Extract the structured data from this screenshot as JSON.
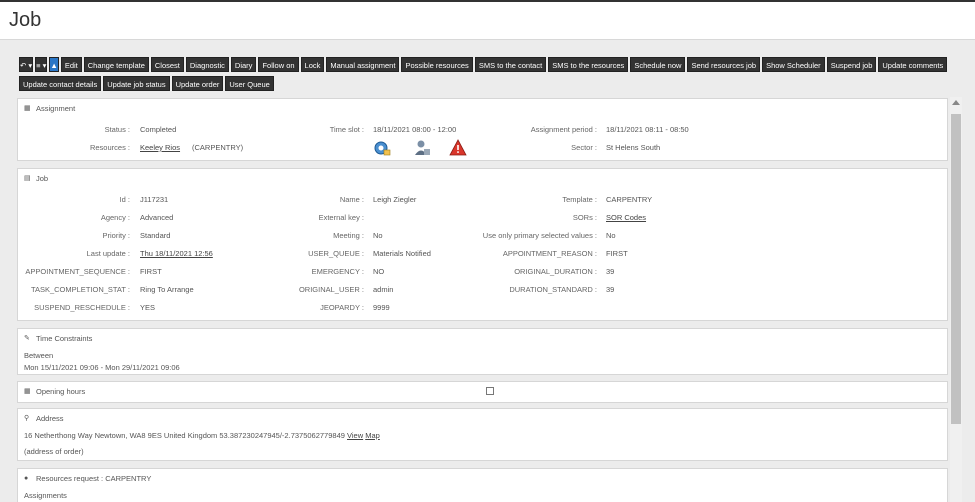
{
  "page": {
    "title": "Job"
  },
  "toolbar": {
    "row1": [
      "Edit",
      "Change template",
      "Closest",
      "Diagnostic",
      "Diary",
      "Follow on",
      "Lock",
      "Manual assignment",
      "Possible resources",
      "SMS to the contact",
      "SMS to the resources",
      "Schedule now",
      "Send resources job",
      "Show Scheduler",
      "Suspend job",
      "Update comments"
    ],
    "row2": [
      "Update contact details",
      "Update job status",
      "Update order",
      "User Queue"
    ]
  },
  "assignment": {
    "header": "Assignment",
    "status_label": "Status :",
    "status": "Completed",
    "resources_label": "Resources :",
    "resource_name": "Keeley Rios",
    "resource_skill": "(CARPENTRY)",
    "timeslot_label": "Time slot :",
    "timeslot": "18/11/2021 08:00 - 12:00",
    "period_label": "Assignment period :",
    "period": "18/11/2021 08:11 - 08:50",
    "sector_label": "Sector :",
    "sector": "St Helens South"
  },
  "job": {
    "header": "Job",
    "id_label": "Id :",
    "id": "J117231",
    "agency_label": "Agency :",
    "agency": "Advanced",
    "priority_label": "Priority :",
    "priority": "Standard",
    "last_update_label": "Last update :",
    "last_update": "Thu 18/11/2021 12:56",
    "appt_seq_label": "APPOINTMENT_SEQUENCE :",
    "appt_seq": "FIRST",
    "task_comp_label": "TASK_COMPLETION_STAT :",
    "task_comp": "Ring To Arrange",
    "suspend_label": "SUSPEND_RESCHEDULE :",
    "suspend": "YES",
    "name_label": "Name :",
    "name": "Leigh Ziegler",
    "extkey_label": "External key :",
    "extkey": "",
    "meeting_label": "Meeting :",
    "meeting": "No",
    "user_queue_label": "USER_QUEUE :",
    "user_queue": "Materials Notified",
    "emergency_label": "EMERGENCY :",
    "emergency": "NO",
    "orig_user_label": "ORIGINAL_USER :",
    "orig_user": "admin",
    "jeopardy_label": "JEOPARDY :",
    "jeopardy": "9999",
    "template_label": "Template :",
    "template": "CARPENTRY",
    "sors_label": "SORs :",
    "sors": "SOR Codes",
    "primary_label": "Use only primary selected values :",
    "primary": "No",
    "appt_reason_label": "APPOINTMENT_REASON :",
    "appt_reason": "FIRST",
    "orig_duration_label": "ORIGINAL_DURATION :",
    "orig_duration": "39",
    "duration_std_label": "DURATION_STANDARD :",
    "duration_std": "39"
  },
  "time_constraints": {
    "header": "Time Constraints",
    "between_label": "Between",
    "range": "Mon 15/11/2021 09:06 - Mon 29/11/2021 09:06"
  },
  "opening_hours": {
    "header": "Opening hours"
  },
  "address": {
    "header": "Address",
    "line": "16 Netherthong Way Newtown, WA8 9ES United Kingdom 53.387230247945/-2.7375062779849",
    "view_link": "View",
    "map_link": "Map",
    "order_note": "(address of order)"
  },
  "resources_request": {
    "header": "Resources request : CARPENTRY",
    "assignments_label": "Assignments"
  }
}
